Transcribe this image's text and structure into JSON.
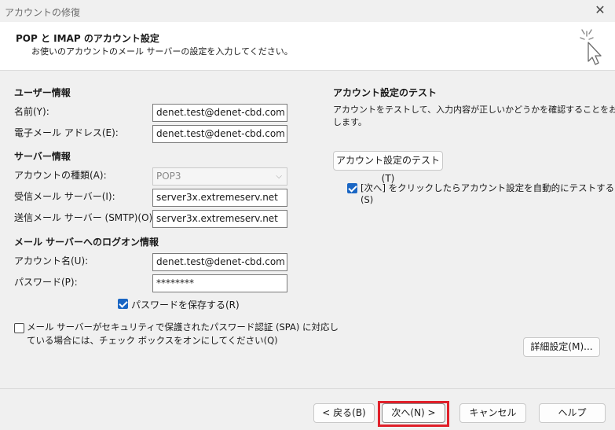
{
  "window": {
    "title": "アカウントの修復",
    "close_glyph": "✕"
  },
  "header": {
    "title": "POP と IMAP のアカウント設定",
    "subtitle": "お使いのアカウントのメール サーバーの設定を入力してください。",
    "icon": "setup-wand-icon"
  },
  "user_info": {
    "heading": "ユーザー情報",
    "name_label": "名前(Y):",
    "name_value": "denet.test@denet-cbd.com",
    "email_label": "電子メール アドレス(E):",
    "email_value": "denet.test@denet-cbd.com"
  },
  "server_info": {
    "heading": "サーバー情報",
    "account_type_label": "アカウントの種類(A):",
    "account_type_value": "POP3",
    "incoming_label": "受信メール サーバー(I):",
    "incoming_value": "server3x.extremeserv.net",
    "outgoing_label": "送信メール サーバー (SMTP)(O):",
    "outgoing_value": "server3x.extremeserv.net"
  },
  "logon_info": {
    "heading": "メール サーバーへのログオン情報",
    "account_name_label": "アカウント名(U):",
    "account_name_value": "denet.test@denet-cbd.com",
    "password_label": "パスワード(P):",
    "password_value": "********",
    "remember_password_label": "パスワードを保存する(R)",
    "remember_password_checked": true,
    "spa_label_line1": "メール サーバーがセキュリティで保護されたパスワード認証 (SPA) に対応し",
    "spa_label_line2": "ている場合には、チェック ボックスをオンにしてください(Q)",
    "spa_checked": false
  },
  "test": {
    "heading": "アカウント設定のテスト",
    "description_line1": "アカウントをテストして、入力内容が正しいかどうかを確認することをお勧め",
    "description_line2": "します。",
    "test_button": "アカウント設定のテスト(T)",
    "auto_test_line1": "[次へ] をクリックしたらアカウント設定を自動的にテストする",
    "auto_test_line2": "(S)",
    "auto_test_checked": true
  },
  "more_settings_button": "詳細設定(M)...",
  "footer": {
    "back": "< 戻る(B)",
    "next": "次へ(N) >",
    "cancel": "キャンセル",
    "help": "ヘルプ"
  },
  "colors": {
    "accent": "#1a66c4",
    "highlight": "#e0202a"
  }
}
